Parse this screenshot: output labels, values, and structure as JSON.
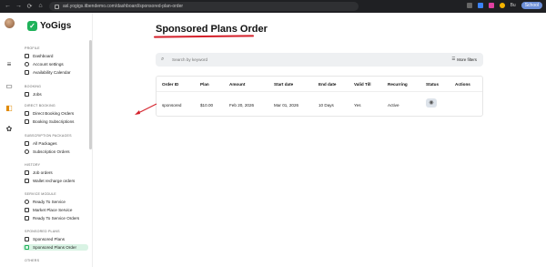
{
  "browser": {
    "url": "asl.yogigs.itbendemo.com/dashboard/sponsored-plan-order",
    "right_text": "Bu",
    "profile_label": "School"
  },
  "app": {
    "logo_text": "YoGigs"
  },
  "sidebar": {
    "sections": [
      {
        "title": "PROFILE",
        "items": [
          "Dashboard",
          "Account settings",
          "Availability Calendar"
        ]
      },
      {
        "title": "BOOKING",
        "items": [
          "Jobs"
        ]
      },
      {
        "title": "DIRECT BOOKING",
        "items": [
          "Direct Booking Orders",
          "Booking Subscriptions"
        ]
      },
      {
        "title": "SUBSCRIPTION PACKAGES",
        "items": [
          "All Packages",
          "Subscription Orders"
        ]
      },
      {
        "title": "HISTORY",
        "items": [
          "Job orders",
          "Wallet recharge orders"
        ]
      },
      {
        "title": "SERVICE MODULE",
        "items": [
          "Ready To Service",
          "Market Place Service",
          "Ready To Service Orders"
        ]
      },
      {
        "title": "SPONSORED PLANS",
        "items": [
          "Sponsored Plans",
          "Sponsored Plans Order"
        ]
      },
      {
        "title": "OTHERS",
        "items": []
      }
    ],
    "active_item": "Sponsored Plans Order"
  },
  "main": {
    "title": "Sponsored Plans Order",
    "search_placeholder": "Search by keyword",
    "filters_label": "More filters",
    "table": {
      "columns": [
        "Order ID",
        "Plan",
        "Amount",
        "Start date",
        "End date",
        "Valid Till",
        "Recurring",
        "Status",
        "Actions"
      ],
      "rows": [
        [
          "sponsored",
          "$10.00",
          "Feb 20, 2026",
          "Mar 01, 2026",
          "10 Days",
          "Yes",
          "Active",
          "",
          ""
        ]
      ]
    }
  },
  "colors": {
    "brand": "#1fb25a",
    "active_bg": "#d9f3e4",
    "annotation_red": "#d4202a"
  }
}
